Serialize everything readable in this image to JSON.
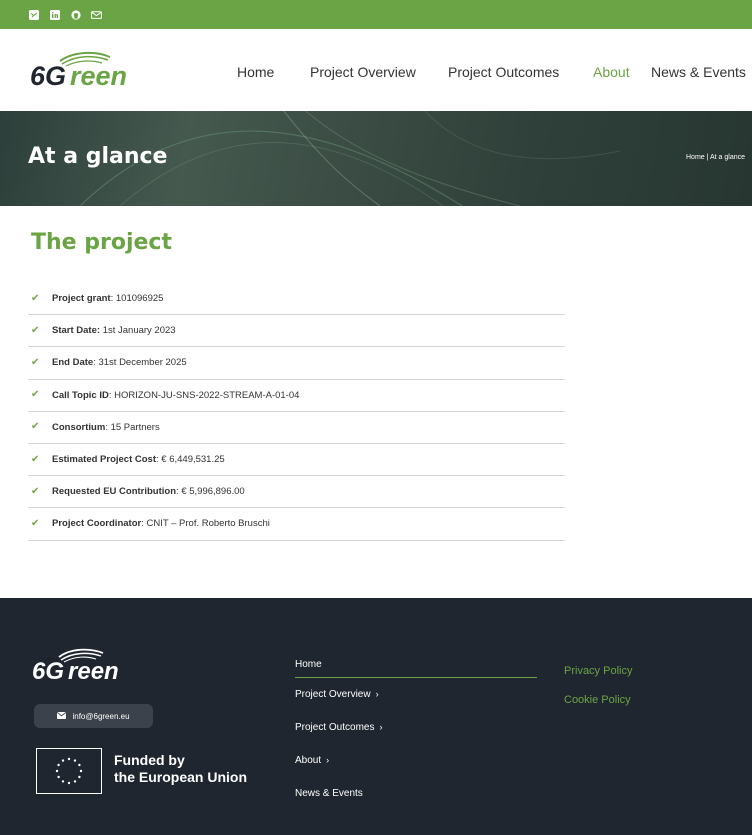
{
  "topbar": {
    "icons": [
      "twitter-icon",
      "linkedin-icon",
      "github-icon",
      "email-icon"
    ]
  },
  "brand": {
    "logo_text": "6Green",
    "color": "#6aa444"
  },
  "nav": {
    "items": [
      {
        "label": "Home"
      },
      {
        "label": "Project Overview"
      },
      {
        "label": "Project Outcomes"
      },
      {
        "label": "About",
        "active": true
      },
      {
        "label": "News & Events"
      }
    ]
  },
  "hero": {
    "title": "At a glance",
    "breadcrumb": "Home | At a glance"
  },
  "main": {
    "section_title": "The project",
    "facts": [
      {
        "label": "Project grant",
        "sep": ": ",
        "value": "101096925"
      },
      {
        "label": "Start Date:",
        "sep": " ",
        "value": "1st January 2023"
      },
      {
        "label": "End Date",
        "sep": ": ",
        "value": "31st December 2025"
      },
      {
        "label": "Call Topic ID",
        "sep": ": ",
        "value": "HORIZON-JU-SNS-2022-STREAM-A-01-04"
      },
      {
        "label": "Consortium",
        "sep": ": ",
        "value": "15 Partners"
      },
      {
        "label": "Estimated Project Cost",
        "sep": ": ",
        "value": "€ 6,449,531.25"
      },
      {
        "label": "Requested EU Contribution",
        "sep": ": ",
        "value": "€ 5,996,896.00"
      },
      {
        "label": "Project Coordinator",
        "sep": ": ",
        "value": "CNIT – Prof. Roberto Bruschi"
      }
    ]
  },
  "footer": {
    "email": "info@6green.eu",
    "funded_line1": "Funded by",
    "funded_line2": "the European Union",
    "menu": [
      {
        "label": "Home",
        "chevron": ""
      },
      {
        "label": "Project Overview",
        "chevron": "›"
      },
      {
        "label": "Project Outcomes",
        "chevron": "›"
      },
      {
        "label": "About",
        "chevron": "›"
      },
      {
        "label": "News & Events",
        "chevron": ""
      }
    ],
    "links": [
      "Privacy Policy",
      "Cookie Policy"
    ],
    "background": "#1f2630"
  }
}
